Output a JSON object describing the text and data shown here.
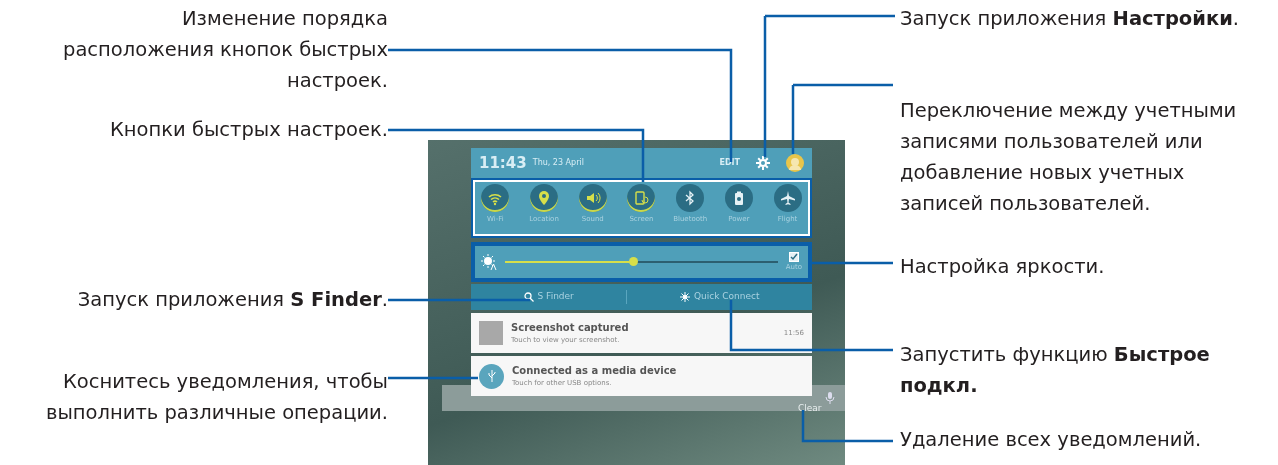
{
  "callouts_left": [
    {
      "text": "Изменение порядка расположения кнопок быстрых настроек."
    },
    {
      "text": "Кнопки быстрых настроек."
    },
    {
      "text": "Запуск приложения **S Finder**."
    },
    {
      "text": "Коснитесь уведомления, чтобы выполнить различные операции."
    }
  ],
  "callouts_right": [
    {
      "text": "Запуск приложения **Настройки**."
    },
    {
      "text": "Переключение между учетными записями пользователей или добавление новых учетных записей пользователей."
    },
    {
      "text": "Настройка яркости."
    },
    {
      "text": "Запустить функцию **Быстрое подкл.**"
    },
    {
      "text": "Удаление всех уведомлений."
    }
  ],
  "screen": {
    "header": {
      "time": "11:43",
      "date": "Thu, 23 April",
      "edit": "EDIT"
    },
    "quick_settings": [
      {
        "kind": "wifi",
        "label": "Wi-Fi",
        "on": true
      },
      {
        "kind": "location",
        "label": "Location",
        "on": true
      },
      {
        "kind": "sound",
        "label": "Sound",
        "on": true
      },
      {
        "kind": "rotation",
        "label": "Screen",
        "on": true
      },
      {
        "kind": "bluetooth",
        "label": "Bluetooth",
        "on": false
      },
      {
        "kind": "battery",
        "label": "Power",
        "on": false
      },
      {
        "kind": "plane",
        "label": "Flight",
        "on": false
      }
    ],
    "brightness": {
      "level": 0.47,
      "auto_label": "Auto",
      "auto_checked": true
    },
    "finder": "S Finder",
    "quick_connect": "Quick Connect",
    "notifications": [
      {
        "kind": "thumbnail",
        "title": "Screenshot captured",
        "text": "Touch to view your screenshot.",
        "time": "11:56"
      },
      {
        "kind": "usb",
        "title": "Connected as a media device",
        "text": "Touch for other USB options."
      }
    ],
    "clear": "Clear"
  }
}
